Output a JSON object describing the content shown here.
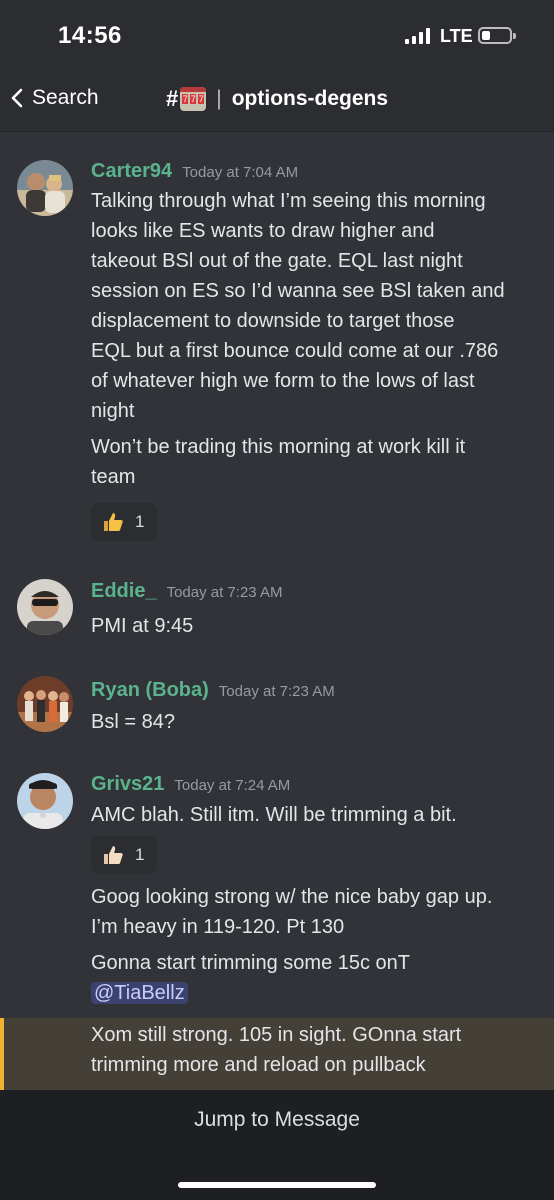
{
  "status_bar": {
    "time": "14:56",
    "network": "LTE"
  },
  "header": {
    "back_label": "Search",
    "channel_hash": "#",
    "channel_name": "options-degens",
    "channel_icon": "slot-machine-icon"
  },
  "messages": [
    {
      "author": "Carter94",
      "timestamp": "Today at 7:04 AM",
      "lines": [
        "Talking through what I’m seeing this morning",
        "looks like ES wants to draw higher and",
        "takeout BSl out of the gate. EQL last night",
        "session on ES so I’d wanna see BSl taken and",
        "displacement to downside to target those",
        "EQL but a first bounce could come at our .786",
        "of whatever high we form to the lows of last",
        "night"
      ],
      "followup_lines": [
        "Won’t be trading this morning at work kill it",
        "team"
      ],
      "reaction": {
        "emoji": "thumbs-up-icon",
        "count": "1"
      }
    },
    {
      "author": "Eddie_",
      "timestamp": "Today at 7:23 AM",
      "text": "PMI at 9:45"
    },
    {
      "author": "Ryan (Boba)",
      "timestamp": "Today at 7:23 AM",
      "text": "Bsl = 84?"
    },
    {
      "author": "Grivs21",
      "timestamp": "Today at 7:24 AM",
      "text": "AMC blah. Still itm. Will be trimming a bit.",
      "reaction": {
        "emoji": "thumbs-up-light-icon",
        "count": "1"
      },
      "followups": [
        {
          "lines": [
            "Goog looking strong w/ the nice baby gap up.",
            "I’m heavy in 119-120. Pt 130"
          ]
        },
        {
          "lines": [
            "Gonna start trimming some 15c onT"
          ],
          "mention": "@TiaBellz"
        },
        {
          "lines": [
            "Xom still strong. 105 in sight. GOnna start",
            "trimming more and reload on pullback"
          ]
        }
      ]
    }
  ],
  "jump_bar": {
    "label": "Jump to Message"
  },
  "colors": {
    "background": "#313338",
    "username": "#5bb38d",
    "mention_bg": "#3c4270",
    "highlight_border": "#f0b232"
  }
}
